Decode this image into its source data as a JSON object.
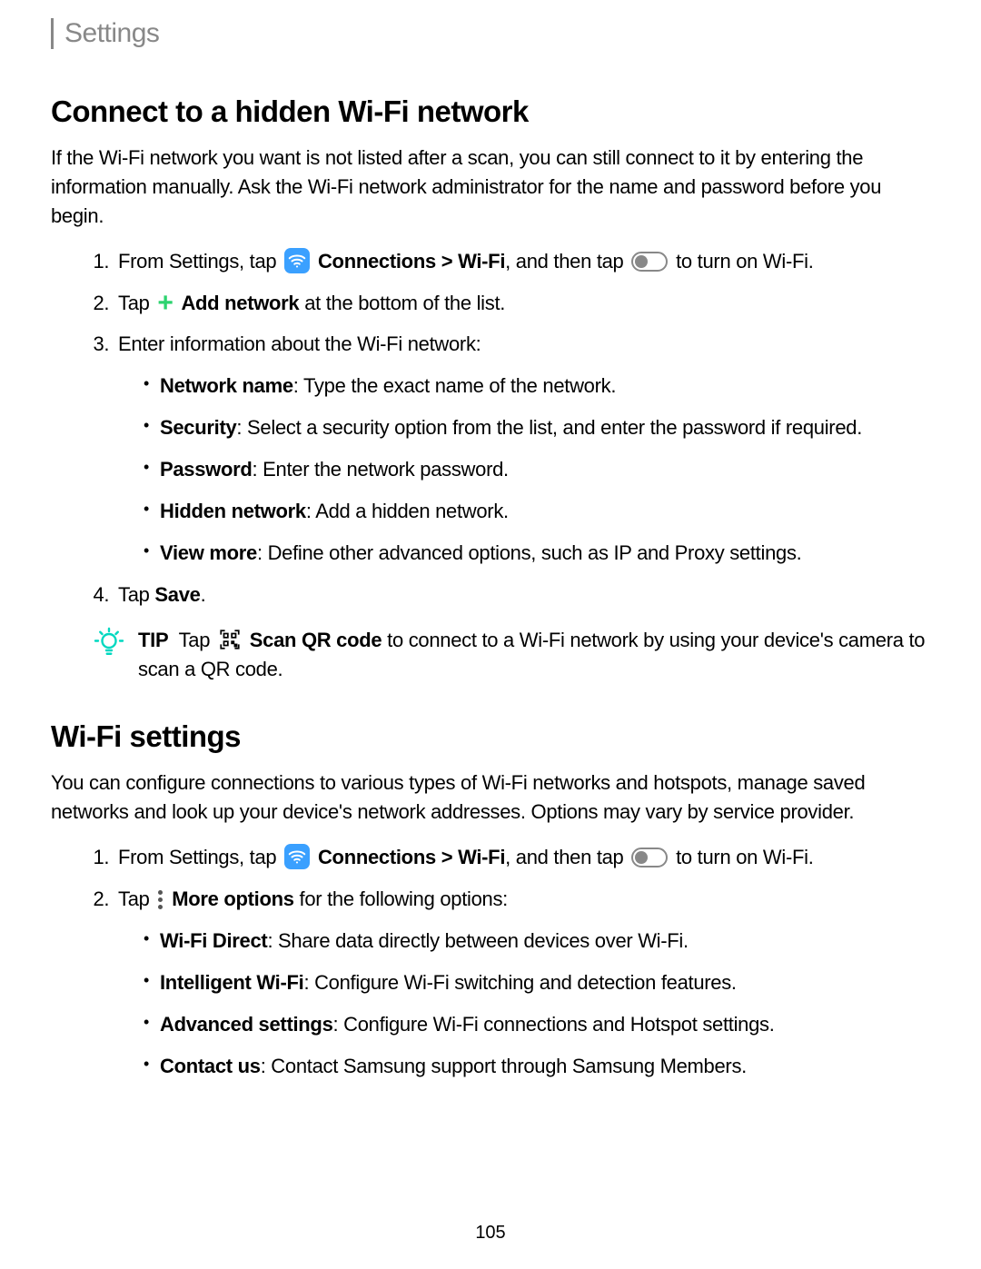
{
  "header": {
    "title": "Settings"
  },
  "section1": {
    "heading": "Connect to a hidden Wi-Fi network",
    "intro": "If the Wi-Fi network you want is not listed after a scan, you can still connect to it by entering the information manually. Ask the Wi-Fi network administrator for the name and password before you begin.",
    "step1_a": "From Settings, tap",
    "step1_b": "Connections > Wi-Fi",
    "step1_c": ", and then tap",
    "step1_d": "to turn on Wi-Fi.",
    "step2_a": "Tap",
    "step2_b": "Add network",
    "step2_c": "at the bottom of the list.",
    "step3": "Enter information about the Wi-Fi network:",
    "sub": {
      "nn_l": "Network name",
      "nn_t": ": Type the exact name of the network.",
      "sec_l": "Security",
      "sec_t": ": Select a security option from the list, and enter the password if required.",
      "pw_l": "Password",
      "pw_t": ": Enter the network password.",
      "hn_l": "Hidden network",
      "hn_t": ": Add a hidden network.",
      "vm_l": "View more",
      "vm_t": ": Define other advanced options, such as IP and Proxy settings."
    },
    "step4_a": "Tap ",
    "step4_b": "Save",
    "step4_c": "."
  },
  "tip": {
    "label": "TIP",
    "a": "Tap",
    "b": "Scan QR code",
    "c": "to connect to a Wi-Fi network by using your device's camera to scan a QR code."
  },
  "section2": {
    "heading": "Wi-Fi settings",
    "intro": "You can configure connections to various types of Wi-Fi networks and hotspots, manage saved networks and look up your device's network addresses. Options may vary by service provider.",
    "step1_a": "From Settings, tap",
    "step1_b": "Connections > Wi-Fi",
    "step1_c": ", and then tap",
    "step1_d": "to turn on Wi-Fi.",
    "step2_a": "Tap",
    "step2_b": "More options",
    "step2_c": "for the following options:",
    "sub": {
      "wd_l": "Wi-Fi Direct",
      "wd_t": ": Share data directly between devices over Wi-Fi.",
      "iw_l": "Intelligent Wi-Fi",
      "iw_t": ": Configure Wi-Fi switching and detection features.",
      "as_l": "Advanced settings",
      "as_t": ": Configure Wi-Fi connections and Hotspot settings.",
      "cu_l": "Contact us",
      "cu_t": ": Contact Samsung support through Samsung Members."
    }
  },
  "page_number": "105"
}
